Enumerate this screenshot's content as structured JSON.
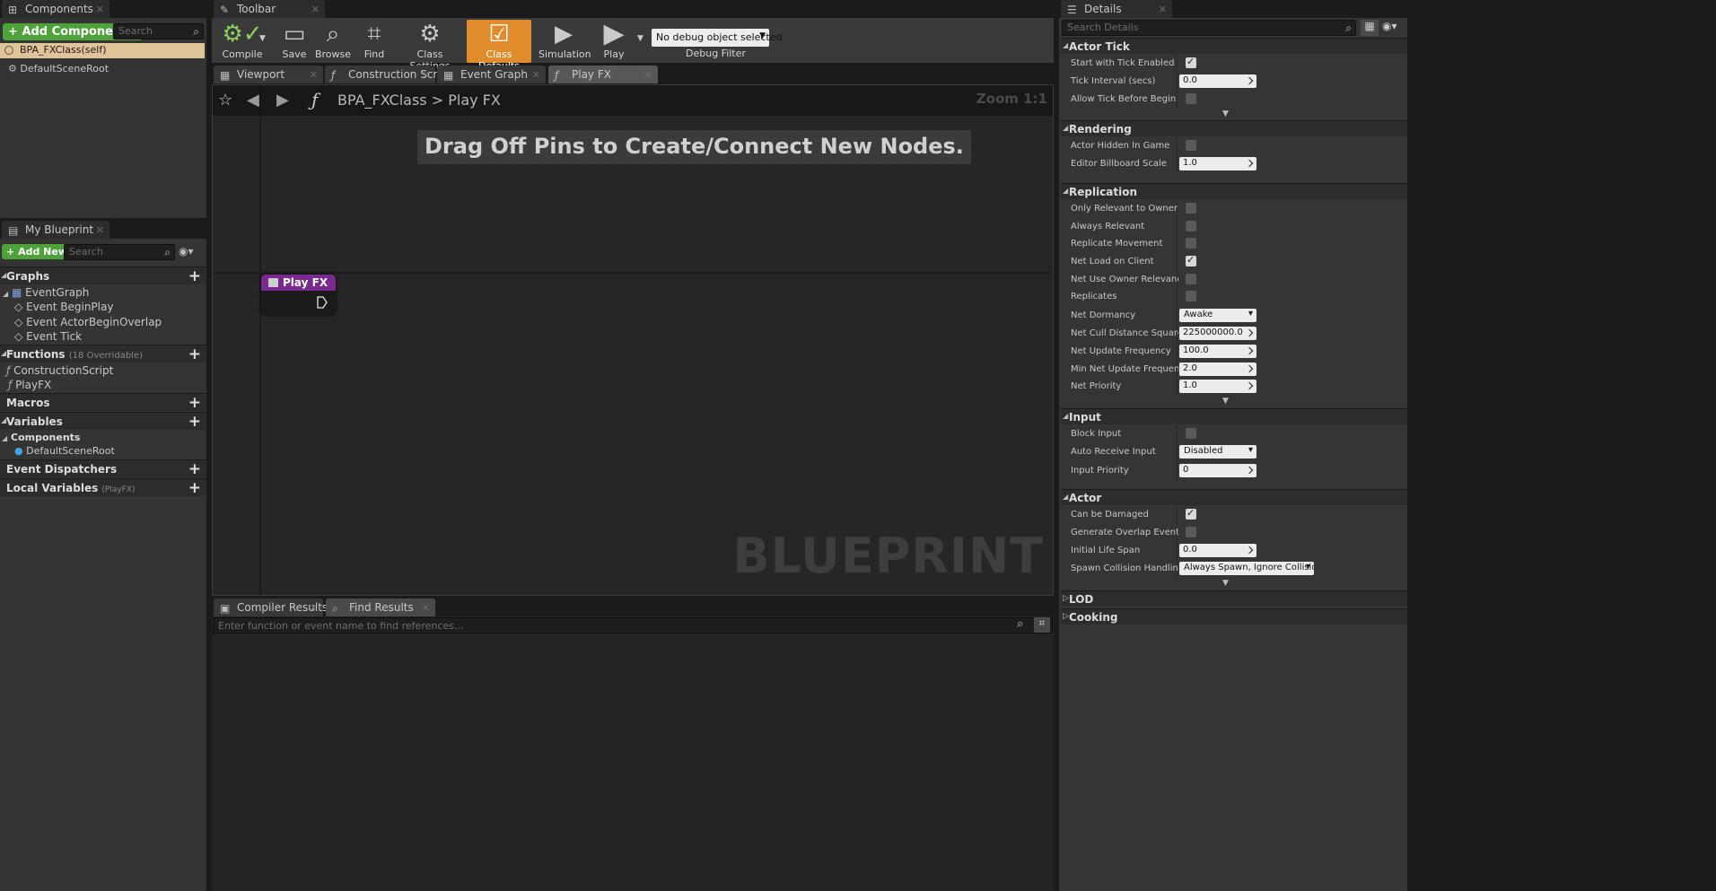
{
  "components": {
    "tab": "Components",
    "add_button": "Add Component",
    "search_placeholder": "Search",
    "self_item": "BPA_FXClass(self)",
    "root_item": "DefaultSceneRoot"
  },
  "toolbar": {
    "tab": "Toolbar",
    "compile": "Compile",
    "save": "Save",
    "browse": "Browse",
    "find": "Find",
    "class_settings": "Class Settings",
    "class_defaults": "Class Defaults",
    "simulation": "Simulation",
    "play": "Play",
    "debug_select": "No debug object selected",
    "debug_filter": "Debug Filter"
  },
  "graph_tabs": [
    "Viewport",
    "Construction Scrip",
    "Event Graph",
    "Play FX"
  ],
  "graph": {
    "breadcrumb_root": "BPA_FXClass",
    "breadcrumb_sep": ">",
    "breadcrumb_leaf": "Play FX",
    "zoom": "Zoom 1:1",
    "hint": "Drag Off Pins to Create/Connect New Nodes.",
    "watermark": "BLUEPRINT",
    "node_title": "Play FX"
  },
  "my_blueprint": {
    "tab": "My Blueprint",
    "add_new": "Add New",
    "search_placeholder": "Search",
    "graphs_label": "Graphs",
    "event_graph": "EventGraph",
    "events": [
      "Event BeginPlay",
      "Event ActorBeginOverlap",
      "Event Tick"
    ],
    "functions_label": "Functions",
    "functions_count": "(18 Overridable)",
    "functions": [
      "ConstructionScript",
      "PlayFX"
    ],
    "macros_label": "Macros",
    "variables_label": "Variables",
    "components_label": "Components",
    "component_var": "DefaultSceneRoot",
    "dispatchers_label": "Event Dispatchers",
    "local_vars_label": "Local Variables",
    "local_vars_scope": "(PlayFX)"
  },
  "bottom": {
    "tab_compiler": "Compiler Results",
    "tab_find": "Find Results",
    "find_placeholder": "Enter function or event name to find references..."
  },
  "details": {
    "tab": "Details",
    "search_placeholder": "Search Details",
    "actor_tick": {
      "label": "Actor Tick",
      "start_with_tick": "Start with Tick Enabled",
      "tick_interval": "Tick Interval (secs)",
      "tick_interval_value": "0.0",
      "allow_tick_before": "Allow Tick Before Begin Play"
    },
    "rendering": {
      "label": "Rendering",
      "hidden_in_game": "Actor Hidden In Game",
      "billboard_scale": "Editor Billboard Scale",
      "billboard_scale_value": "1.0"
    },
    "replication": {
      "label": "Replication",
      "only_relevant_owner": "Only Relevant to Owner",
      "always_relevant": "Always Relevant",
      "replicate_movement": "Replicate Movement",
      "net_load_on_client": "Net Load on Client",
      "net_use_owner_relevancy": "Net Use Owner Relevancy",
      "replicates": "Replicates",
      "net_dormancy": "Net Dormancy",
      "net_dormancy_value": "Awake",
      "net_cull_distance": "Net Cull Distance Squared",
      "net_cull_distance_value": "225000000.0",
      "net_update_freq": "Net Update Frequency",
      "net_update_freq_value": "100.0",
      "min_net_update_freq": "Min Net Update Frequency",
      "min_net_update_freq_value": "2.0",
      "net_priority": "Net Priority",
      "net_priority_value": "1.0"
    },
    "input": {
      "label": "Input",
      "block_input": "Block Input",
      "auto_receive": "Auto Receive Input",
      "auto_receive_value": "Disabled",
      "input_priority": "Input Priority",
      "input_priority_value": "0"
    },
    "actor": {
      "label": "Actor",
      "can_be_damaged": "Can be Damaged",
      "gen_overlap": "Generate Overlap Events Dur",
      "initial_life_span": "Initial Life Span",
      "initial_life_span_value": "0.0",
      "spawn_collision": "Spawn Collision Handling Me",
      "spawn_collision_value": "Always Spawn, Ignore Collisions"
    },
    "lod_label": "LOD",
    "cooking_label": "Cooking"
  }
}
